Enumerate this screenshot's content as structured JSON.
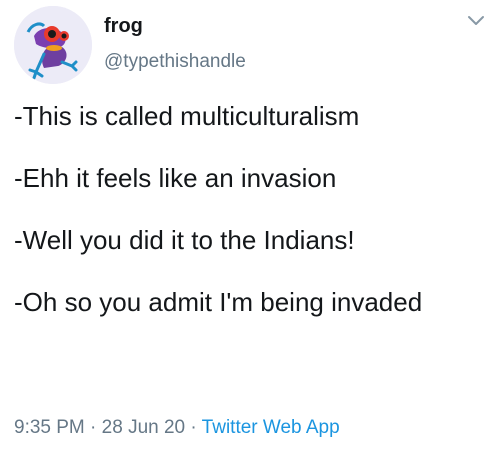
{
  "tweet": {
    "display_name": "frog",
    "handle": "@typethishandle",
    "lines": [
      "-This is called multiculturalism",
      "-Ehh it feels like an invasion",
      "-Well you did it to the Indians!",
      "-Oh so you admit I'm being invaded"
    ],
    "time": "9:35 PM",
    "separator": "·",
    "date": "28 Jun 20",
    "source_app": "Twitter Web App"
  },
  "icons": {
    "more": "chevron-down-icon",
    "avatar": "frog-avatar"
  },
  "colors": {
    "text": "#14171a",
    "secondary": "#657786",
    "link": "#1b95e0",
    "background": "#ffffff"
  }
}
